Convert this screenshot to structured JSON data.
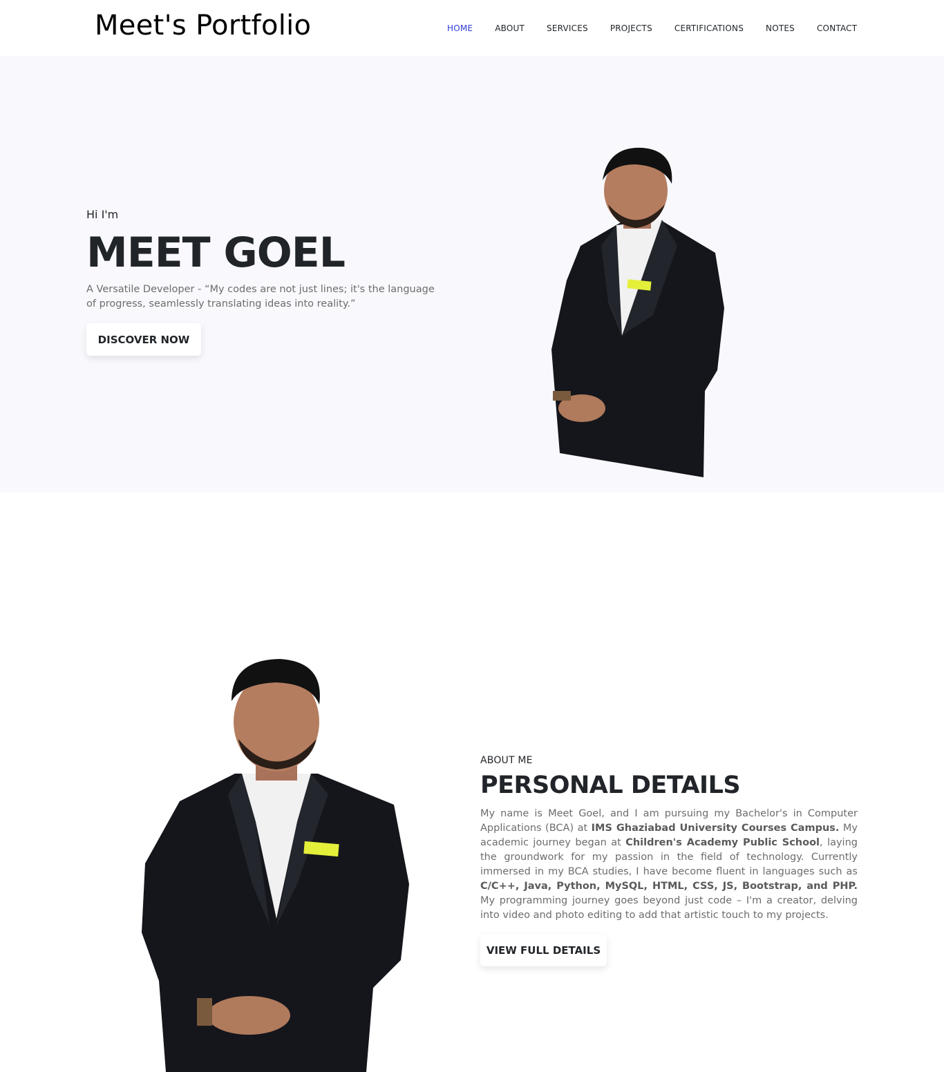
{
  "header": {
    "brand": "Meet's Portfolio",
    "nav": [
      {
        "label": "HOME",
        "active": true
      },
      {
        "label": "ABOUT",
        "active": false
      },
      {
        "label": "SERVICES",
        "active": false
      },
      {
        "label": "PROJECTS",
        "active": false
      },
      {
        "label": "CERTIFICATIONS",
        "active": false
      },
      {
        "label": "NOTES",
        "active": false
      },
      {
        "label": "CONTACT",
        "active": false
      }
    ],
    "active_color": "#2e3bd6"
  },
  "hero": {
    "greeting": "Hi I'm",
    "name": "MEET GOEL",
    "description": "A Versatile Developer - “My codes are not just lines; it's the language of progress, seamlessly translating ideas into reality.”",
    "button_label": "DISCOVER NOW",
    "background": "#f9f9fd"
  },
  "about": {
    "eyebrow": "ABOUT ME",
    "title": "PERSONAL DETAILS",
    "paragraph": {
      "p1": "My name is Meet Goel, and I am pursuing my Bachelor's in Computer Applications (BCA) at ",
      "b1": "IMS Ghaziabad University Courses Campus.",
      "p2": " My academic journey began at ",
      "b2": "Children's Academy Public School",
      "p3": ", laying the groundwork for my passion in the field of technology. Currently immersed in my BCA studies, I have become fluent in languages such as ",
      "b3": "C/C++, Java, Python, MySQL, HTML, CSS, JS, Bootstrap, and PHP.",
      "p4": " My programming journey goes beyond just code – I'm a creator, delving into video and photo editing to add that artistic touch to my projects."
    },
    "button_label": "VIEW FULL DETAILS"
  },
  "badge_color": "#e4ef3a"
}
